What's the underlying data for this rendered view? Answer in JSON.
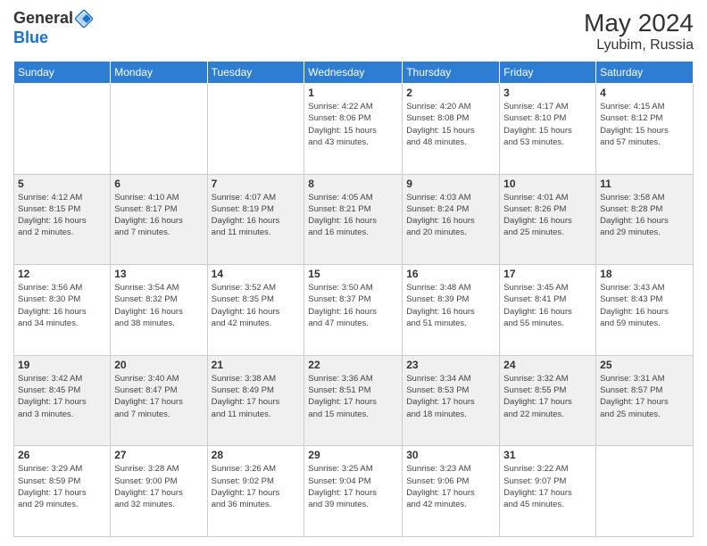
{
  "logo": {
    "general": "General",
    "blue": "Blue"
  },
  "header": {
    "month": "May 2024",
    "location": "Lyubim, Russia"
  },
  "days_of_week": [
    "Sunday",
    "Monday",
    "Tuesday",
    "Wednesday",
    "Thursday",
    "Friday",
    "Saturday"
  ],
  "weeks": [
    [
      {
        "num": "",
        "info": ""
      },
      {
        "num": "",
        "info": ""
      },
      {
        "num": "",
        "info": ""
      },
      {
        "num": "1",
        "info": "Sunrise: 4:22 AM\nSunset: 8:06 PM\nDaylight: 15 hours\nand 43 minutes."
      },
      {
        "num": "2",
        "info": "Sunrise: 4:20 AM\nSunset: 8:08 PM\nDaylight: 15 hours\nand 48 minutes."
      },
      {
        "num": "3",
        "info": "Sunrise: 4:17 AM\nSunset: 8:10 PM\nDaylight: 15 hours\nand 53 minutes."
      },
      {
        "num": "4",
        "info": "Sunrise: 4:15 AM\nSunset: 8:12 PM\nDaylight: 15 hours\nand 57 minutes."
      }
    ],
    [
      {
        "num": "5",
        "info": "Sunrise: 4:12 AM\nSunset: 8:15 PM\nDaylight: 16 hours\nand 2 minutes."
      },
      {
        "num": "6",
        "info": "Sunrise: 4:10 AM\nSunset: 8:17 PM\nDaylight: 16 hours\nand 7 minutes."
      },
      {
        "num": "7",
        "info": "Sunrise: 4:07 AM\nSunset: 8:19 PM\nDaylight: 16 hours\nand 11 minutes."
      },
      {
        "num": "8",
        "info": "Sunrise: 4:05 AM\nSunset: 8:21 PM\nDaylight: 16 hours\nand 16 minutes."
      },
      {
        "num": "9",
        "info": "Sunrise: 4:03 AM\nSunset: 8:24 PM\nDaylight: 16 hours\nand 20 minutes."
      },
      {
        "num": "10",
        "info": "Sunrise: 4:01 AM\nSunset: 8:26 PM\nDaylight: 16 hours\nand 25 minutes."
      },
      {
        "num": "11",
        "info": "Sunrise: 3:58 AM\nSunset: 8:28 PM\nDaylight: 16 hours\nand 29 minutes."
      }
    ],
    [
      {
        "num": "12",
        "info": "Sunrise: 3:56 AM\nSunset: 8:30 PM\nDaylight: 16 hours\nand 34 minutes."
      },
      {
        "num": "13",
        "info": "Sunrise: 3:54 AM\nSunset: 8:32 PM\nDaylight: 16 hours\nand 38 minutes."
      },
      {
        "num": "14",
        "info": "Sunrise: 3:52 AM\nSunset: 8:35 PM\nDaylight: 16 hours\nand 42 minutes."
      },
      {
        "num": "15",
        "info": "Sunrise: 3:50 AM\nSunset: 8:37 PM\nDaylight: 16 hours\nand 47 minutes."
      },
      {
        "num": "16",
        "info": "Sunrise: 3:48 AM\nSunset: 8:39 PM\nDaylight: 16 hours\nand 51 minutes."
      },
      {
        "num": "17",
        "info": "Sunrise: 3:45 AM\nSunset: 8:41 PM\nDaylight: 16 hours\nand 55 minutes."
      },
      {
        "num": "18",
        "info": "Sunrise: 3:43 AM\nSunset: 8:43 PM\nDaylight: 16 hours\nand 59 minutes."
      }
    ],
    [
      {
        "num": "19",
        "info": "Sunrise: 3:42 AM\nSunset: 8:45 PM\nDaylight: 17 hours\nand 3 minutes."
      },
      {
        "num": "20",
        "info": "Sunrise: 3:40 AM\nSunset: 8:47 PM\nDaylight: 17 hours\nand 7 minutes."
      },
      {
        "num": "21",
        "info": "Sunrise: 3:38 AM\nSunset: 8:49 PM\nDaylight: 17 hours\nand 11 minutes."
      },
      {
        "num": "22",
        "info": "Sunrise: 3:36 AM\nSunset: 8:51 PM\nDaylight: 17 hours\nand 15 minutes."
      },
      {
        "num": "23",
        "info": "Sunrise: 3:34 AM\nSunset: 8:53 PM\nDaylight: 17 hours\nand 18 minutes."
      },
      {
        "num": "24",
        "info": "Sunrise: 3:32 AM\nSunset: 8:55 PM\nDaylight: 17 hours\nand 22 minutes."
      },
      {
        "num": "25",
        "info": "Sunrise: 3:31 AM\nSunset: 8:57 PM\nDaylight: 17 hours\nand 25 minutes."
      }
    ],
    [
      {
        "num": "26",
        "info": "Sunrise: 3:29 AM\nSunset: 8:59 PM\nDaylight: 17 hours\nand 29 minutes."
      },
      {
        "num": "27",
        "info": "Sunrise: 3:28 AM\nSunset: 9:00 PM\nDaylight: 17 hours\nand 32 minutes."
      },
      {
        "num": "28",
        "info": "Sunrise: 3:26 AM\nSunset: 9:02 PM\nDaylight: 17 hours\nand 36 minutes."
      },
      {
        "num": "29",
        "info": "Sunrise: 3:25 AM\nSunset: 9:04 PM\nDaylight: 17 hours\nand 39 minutes."
      },
      {
        "num": "30",
        "info": "Sunrise: 3:23 AM\nSunset: 9:06 PM\nDaylight: 17 hours\nand 42 minutes."
      },
      {
        "num": "31",
        "info": "Sunrise: 3:22 AM\nSunset: 9:07 PM\nDaylight: 17 hours\nand 45 minutes."
      },
      {
        "num": "",
        "info": ""
      }
    ]
  ]
}
